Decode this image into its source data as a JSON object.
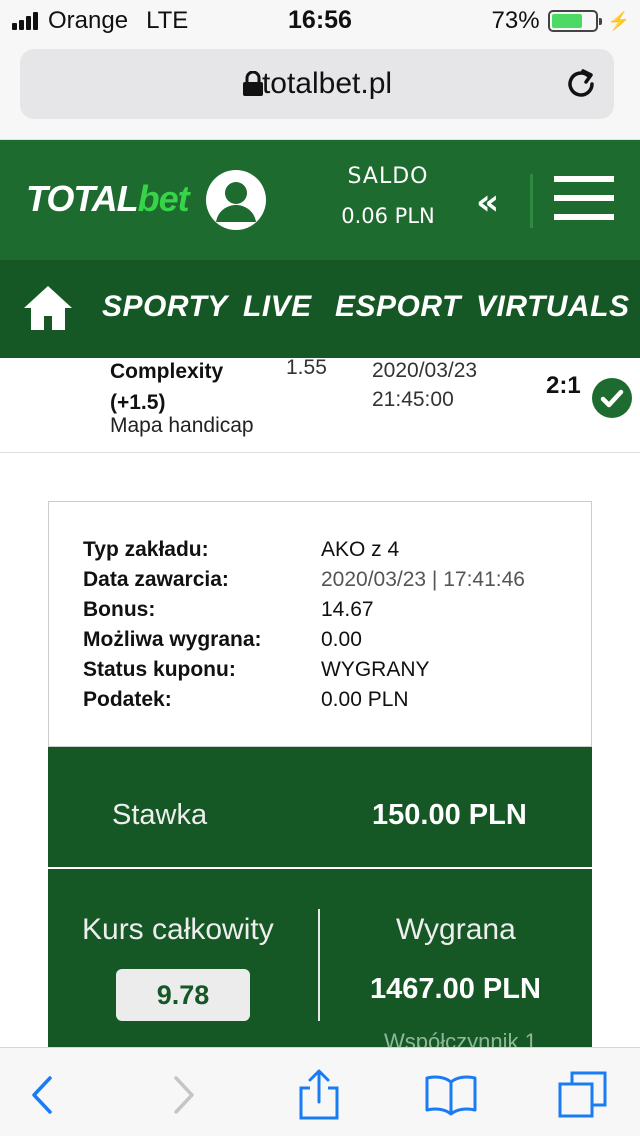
{
  "status_bar": {
    "carrier": "Orange",
    "network": "LTE",
    "time": "16:56",
    "battery": "73%",
    "battery_level": 0.73
  },
  "browser": {
    "url": "totalbet.pl"
  },
  "header": {
    "logo_total": "TOTAL",
    "logo_bet": "bet",
    "saldo_label": "SALDO",
    "saldo_value": "0.06 PLN",
    "collapse_glyph": "«"
  },
  "nav": {
    "items": [
      "SPORTY",
      "LIVE",
      "ESPORT",
      "VIRTUALS"
    ]
  },
  "bet": {
    "team_line1": "Complexity",
    "team_line2": "(+1.5)",
    "market": "Mapa handicap",
    "odd": "1.55",
    "date_line1": "2020/03/23",
    "date_line2": "21:45:00",
    "score": "2:1"
  },
  "details": {
    "rows": [
      {
        "key": "Typ zakładu:",
        "value": "AKO z 4"
      },
      {
        "key": "Data zawarcia:",
        "value": "2020/03/23 | 17:41:46"
      },
      {
        "key": "Bonus:",
        "value": "14.67"
      },
      {
        "key": "Możliwa wygrana:",
        "value": "0.00"
      },
      {
        "key": "Status kuponu:",
        "value": "WYGRANY"
      },
      {
        "key": "Podatek:",
        "value": "0.00 PLN"
      }
    ]
  },
  "stake": {
    "label": "Stawka",
    "value": "150.00 PLN"
  },
  "totals": {
    "odds_label": "Kurs całkowity",
    "odds_value": "9.78",
    "win_label": "Wygrana",
    "win_value": "1467.00 PLN",
    "coefficient": "Współczynnik 1"
  },
  "icons": {
    "lock": "lock-icon",
    "reload": "reload-icon",
    "avatar": "user-avatar-icon",
    "menu": "hamburger-menu-icon",
    "home": "home-icon",
    "check": "check-circle-icon",
    "back": "chevron-left-icon",
    "forward": "chevron-right-icon",
    "share": "share-icon",
    "bookmarks": "bookmarks-icon",
    "tabs": "tabs-icon"
  },
  "colors": {
    "brand_green": "#1d6b2e",
    "nav_green": "#165825",
    "accent_green": "#37d44a",
    "ios_blue": "#1a7cf5"
  }
}
